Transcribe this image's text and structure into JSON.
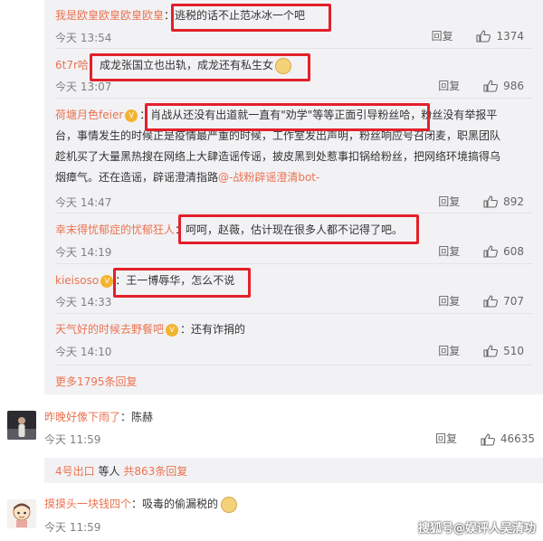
{
  "replies": [
    {
      "user": "我是欧皇欧皇欧皇欧皇",
      "sep": "：",
      "text": "逃税的话不止范冰冰一个吧",
      "time": "今天 13:54",
      "reply": "回复",
      "likes": "1374"
    },
    {
      "user": "6t7r哈",
      "sep": "：",
      "text": "成龙张国立也出轨，成龙还有私生女",
      "time": "今天 13:07",
      "reply": "回复",
      "likes": "986"
    },
    {
      "user": "荷塘月色feier",
      "sep": "：",
      "text_lines": [
        "肖战从还没有出道就一直有\"劝学\"等等正面引导粉丝哈，粉丝没有举报平",
        "台，事情发生的时候正是疫情最严重的时候，工作室发出声明，粉丝响应号召闭麦，职黑团队",
        "趁机买了大量黑热搜在网络上大肆造谣传谣，披皮黑到处惹事扣锅给粉丝，把网络环境搞得乌",
        "烟瘴气。还在造谣，辟谣澄清指路"
      ],
      "link": "@-战粉辟谣澄清bot-",
      "time": "今天 14:47",
      "reply": "回复",
      "likes": "892"
    },
    {
      "user": "幸末得忧郁症的忧郁狂人",
      "sep": "：",
      "text": "呵呵，赵薇，估计现在很多人都不记得了吧。",
      "time": "今天 14:19",
      "reply": "回复",
      "likes": "608"
    },
    {
      "user": "kieisoso",
      "sep": "：",
      "text": "王一博辱华，怎么不说",
      "time": "今天 14:33",
      "reply": "回复",
      "likes": "707"
    },
    {
      "user": "天气好的时候去野餐吧",
      "sep": "：",
      "text": "还有诈捐的",
      "time": "今天 14:10",
      "reply": "回复",
      "likes": "510"
    }
  ],
  "more_replies": "更多1795条回复",
  "comments": [
    {
      "user": "昨晚好像下雨了",
      "sep": "：",
      "text": "陈赫",
      "time": "今天 11:59",
      "reply": "回复",
      "likes": "46635"
    },
    {
      "user": "摸摸头一块钱四个",
      "sep": "：",
      "text": "吸毒的偷漏税的",
      "time": "今天 11:59"
    }
  ],
  "sub_replies": {
    "user": "4号出口",
    "mid": "等人",
    "count": "共863条回复"
  },
  "watermark": "搜狐号@娱评人吴清功",
  "colors": {
    "link": "#eb7350",
    "highlight": "#e3202a",
    "reply_bg": "#f2f2f5"
  }
}
